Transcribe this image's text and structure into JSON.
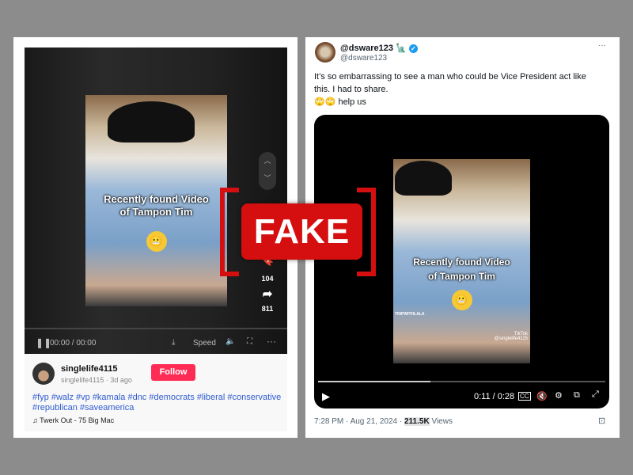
{
  "tiktok": {
    "video_caption_line1": "Recently found Video",
    "video_caption_line2": "of Tampon Tim",
    "emoji": "😬",
    "bookmark_count": "104",
    "share_count": "811",
    "time": "00:00 / 00:00",
    "speed_label": "Speed",
    "username": "singlelife4115",
    "subline": "singlelife4115 · 3d ago",
    "follow_label": "Follow",
    "hashtags_line1": "#fyp #walz #vp #kamala #dnc #democrats #liberal #conservative",
    "hashtags_line2": "#republican #saveamerica",
    "sound": "Twerk Out - 75 Big Mac"
  },
  "tweet": {
    "display_name": "@dsware123",
    "handle": "@dsware123",
    "more": "···",
    "text_line1": "It’s so embarrassing to see a man who could be Vice President act like",
    "text_line2": "this. I had to share.",
    "text_line3": "🙄🙄 help us",
    "video_caption_line1": "Recently found Video",
    "video_caption_line2": "of Tampon Tim",
    "emoji": "😬",
    "watermark": "TRIPWITHLALA",
    "tiktok_logo": "TikTok",
    "tiktok_user": "@singlelife4115",
    "time": "0:11 / 0:28",
    "progress": 0.39,
    "timestamp": "7:28 PM · Aug 21, 2024 · ",
    "views_count": "211.5K",
    "views_label": " Views"
  },
  "stamp": {
    "label": "FAKE",
    "color": "#d50f0f"
  }
}
